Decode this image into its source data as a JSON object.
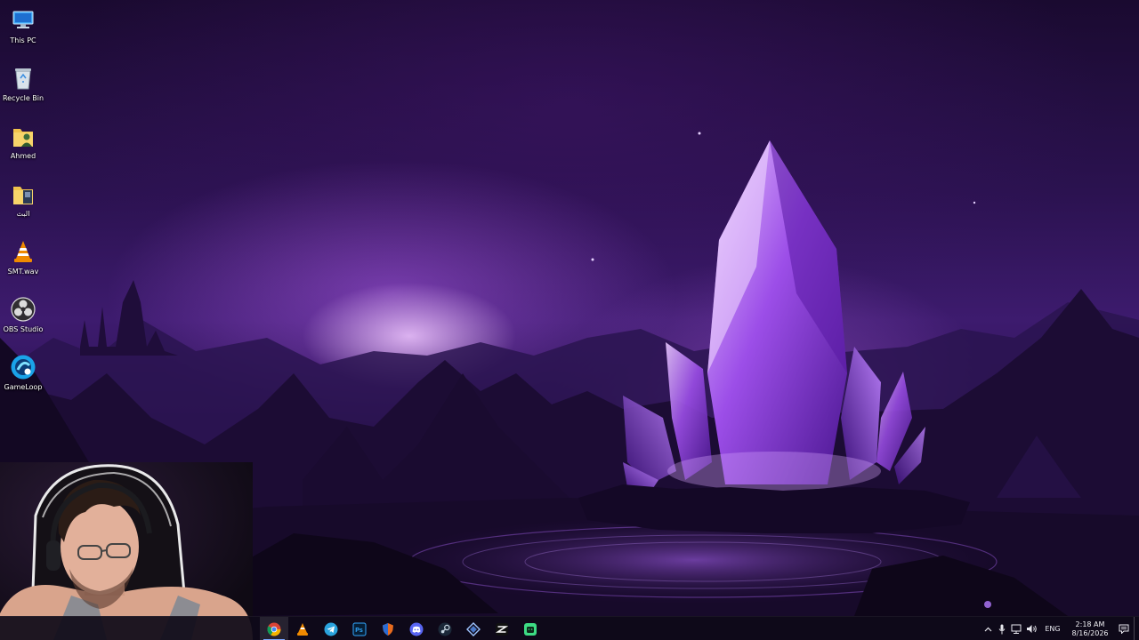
{
  "desktop": {
    "icons": [
      {
        "label": "This PC",
        "icon": "this-pc-icon"
      },
      {
        "label": "Recycle Bin",
        "icon": "recycle-bin-icon"
      },
      {
        "label": "Ahmed",
        "icon": "user-folder-icon"
      },
      {
        "label": "البث",
        "icon": "folder-icon"
      },
      {
        "label": "SMT.wav",
        "icon": "vlc-icon"
      },
      {
        "label": "OBS Studio",
        "icon": "obs-icon"
      },
      {
        "label": "GameLoop",
        "icon": "gameloop-icon"
      }
    ]
  },
  "taskbar": {
    "apps": [
      {
        "name": "Google Chrome",
        "icon": "chrome-icon",
        "active": true
      },
      {
        "name": "VLC media player",
        "icon": "vlc-icon",
        "active": false
      },
      {
        "name": "Telegram",
        "icon": "telegram-icon",
        "active": false
      },
      {
        "name": "Adobe Photoshop",
        "icon": "photoshop-icon",
        "active": false
      },
      {
        "name": "Firewall",
        "icon": "shield-icon",
        "active": false
      },
      {
        "name": "Discord",
        "icon": "discord-icon",
        "active": false
      },
      {
        "name": "Steam",
        "icon": "steam-icon",
        "active": false
      },
      {
        "name": "Launcher",
        "icon": "diamond-app-icon",
        "active": false
      },
      {
        "name": "CapCut",
        "icon": "capcut-icon",
        "active": false
      },
      {
        "name": "Mobile companion",
        "icon": "android-icon",
        "active": false
      }
    ],
    "tray": {
      "language": "ENG",
      "time": "2:18 AM",
      "date": "8/16/2026"
    }
  },
  "colors": {
    "accent": "#7aa7ff",
    "taskbar_bg": "#0e0a18",
    "wallpaper_purple": "#3d1b6e"
  }
}
